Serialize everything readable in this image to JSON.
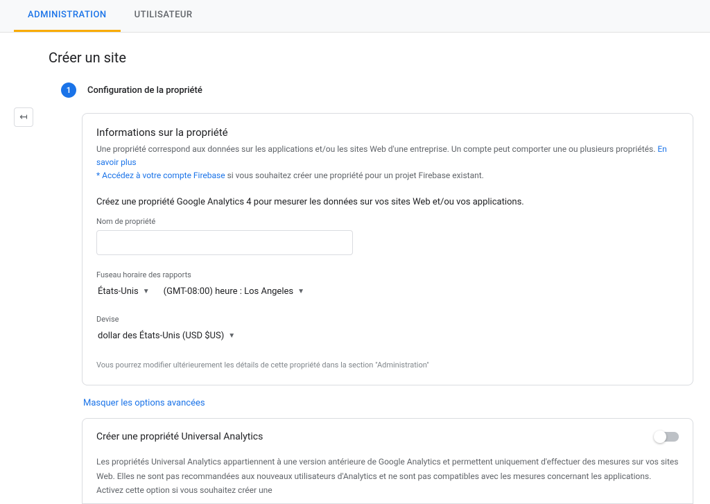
{
  "tabs": {
    "admin": "ADMINISTRATION",
    "user": "UTILISATEUR"
  },
  "pageTitle": "Créer un site",
  "backIcon": "↤",
  "step": {
    "num": "1",
    "title": "Configuration de la propriété"
  },
  "card": {
    "title": "Informations sur la propriété",
    "desc": "Une propriété correspond aux données sur les applications et/ou les sites Web d'une entreprise. Un compte peut comporter une ou plusieurs propriétés.",
    "descLink": "En savoir plus",
    "firebasePrefix": "*",
    "firebaseLink": "Accédez à votre compte Firebase",
    "firebaseRest": "si vous souhaitez créer une propriété pour un projet Firebase existant.",
    "instruction": "Créez une propriété Google Analytics 4 pour mesurer les données sur vos sites Web et/ou vos applications.",
    "propNameLabel": "Nom de propriété",
    "tzLabel": "Fuseau horaire des rapports",
    "tzCountry": "États-Unis",
    "tzValue": "(GMT-08:00) heure : Los Angeles",
    "currencyLabel": "Devise",
    "currencyValue": "dollar des États-Unis (USD $US)",
    "note": "Vous pourrez modifier ultérieurement les détails de cette propriété dans la section \"Administration\""
  },
  "advLink": "Masquer les options avancées",
  "card2": {
    "title": "Créer une propriété Universal Analytics",
    "body": "Les propriétés Universal Analytics appartiennent à une version antérieure de Google Analytics et permettent uniquement d'effectuer des mesures sur vos sites Web. Elles ne sont pas recommandées aux nouveaux utilisateurs d'Analytics et ne sont pas compatibles avec les mesures concernant les applications. Activez cette option si vous souhaitez créer une"
  }
}
